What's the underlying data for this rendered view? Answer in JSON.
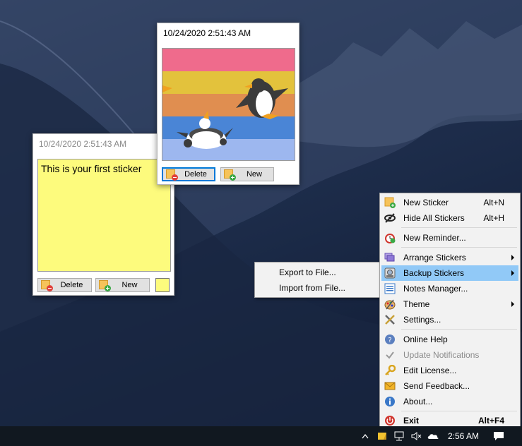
{
  "stickers": [
    {
      "timestamp": "10/24/2020 2:51:43 AM",
      "text": "This is your first sticker",
      "delete_label": "Delete",
      "new_label": "New",
      "color": "#fdfb7d"
    },
    {
      "timestamp": "10/24/2020 2:51:43 AM",
      "delete_label": "Delete",
      "new_label": "New",
      "stripe_colors": [
        "#ef6b8c",
        "#e3c23c",
        "#e08e50",
        "#4a85d6",
        "#9db7ef"
      ]
    }
  ],
  "context_menu": {
    "items": [
      {
        "label": "New Sticker",
        "shortcut": "Alt+N",
        "icon": "new-sticker-icon"
      },
      {
        "label": "Hide All Stickers",
        "shortcut": "Alt+H",
        "icon": "hide-eye-icon"
      },
      {
        "label": "New Reminder...",
        "icon": "alarm-clock-icon"
      },
      {
        "label": "Arrange Stickers",
        "icon": "arrange-icon",
        "submenu": true
      },
      {
        "label": "Backup Stickers",
        "icon": "backup-icon",
        "submenu": true,
        "highlighted": true
      },
      {
        "label": "Notes Manager...",
        "icon": "notes-manager-icon"
      },
      {
        "label": "Theme",
        "icon": "palette-icon",
        "submenu": true
      },
      {
        "label": "Settings...",
        "icon": "settings-tools-icon"
      },
      {
        "label": "Online Help",
        "icon": "help-icon"
      },
      {
        "label": "Update Notifications",
        "icon": "checkmark-icon",
        "disabled": true
      },
      {
        "label": "Edit License...",
        "icon": "key-icon"
      },
      {
        "label": "Send Feedback...",
        "icon": "envelope-icon"
      },
      {
        "label": "About...",
        "icon": "info-icon"
      },
      {
        "label": "Exit",
        "shortcut": "Alt+F4",
        "icon": "power-icon",
        "bold": true
      }
    ]
  },
  "backup_submenu": {
    "items": [
      {
        "label": "Export to File..."
      },
      {
        "label": "Import from File..."
      }
    ]
  },
  "taskbar": {
    "time": "2:56 AM"
  },
  "colors": {
    "highlight": "#91c9f7",
    "menu_bg": "#f2f2f2",
    "taskbar": "#111820"
  }
}
